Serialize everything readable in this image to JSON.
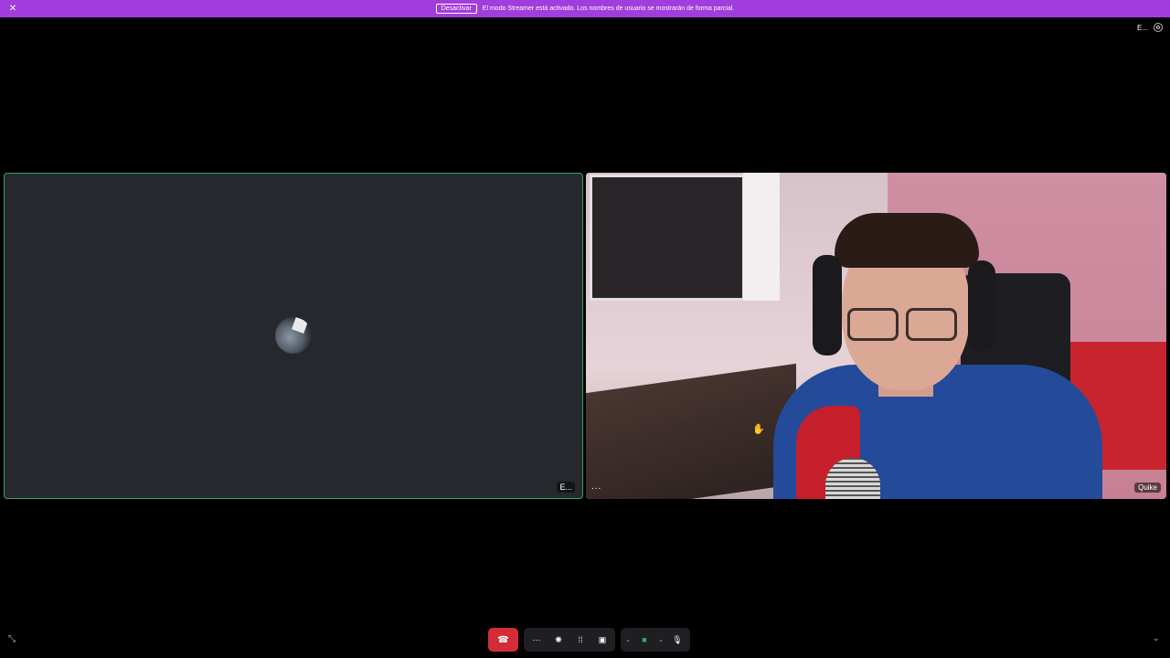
{
  "banner": {
    "close_icon": "close-icon",
    "button_label": "Desactivar",
    "message": "El modo Streamer está activado. Los nombres de usuario se mostrarán de forma parcial."
  },
  "top_right": {
    "label": "E...",
    "icon": "settings-icon"
  },
  "tiles": {
    "left": {
      "more_label": "E...",
      "border_color": "#3ba55c"
    },
    "right": {
      "more_label": "...",
      "name": "Quike"
    }
  },
  "toolbar": {
    "hangup_icon": "phone-hangup-icon",
    "more_icon": "more-icon",
    "activity_icon": "activity-icon",
    "apps_icon": "apps-icon",
    "screen_share_icon": "screen-share-icon",
    "camera_icon": "camera-icon",
    "mic_icon": "mic-icon"
  },
  "colors": {
    "banner": "#a23ddd",
    "hangup": "#d22d39",
    "speaking": "#3ba55c"
  }
}
